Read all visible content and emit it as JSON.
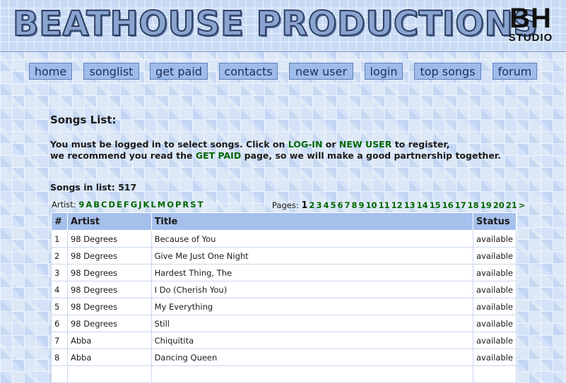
{
  "header": {
    "title": "BEATHOUSE PRODUCTIONS",
    "logo_main": "BH",
    "logo_sub": "STUDIO"
  },
  "nav": [
    "home",
    "songlist",
    "get paid",
    "contacts",
    "new user",
    "login",
    "top songs",
    "forum"
  ],
  "content": {
    "heading": "Songs List:",
    "notice": {
      "part1": "You must be logged in to select songs. Click on ",
      "login_link": "LOG-IN",
      "part2": " or ",
      "newuser_link": "NEW USER",
      "part3": " to register,",
      "part4": "we recommend you read the ",
      "getpaid_link": "GET PAID",
      "part5": " page, so we will make a good partnership together."
    },
    "count_label": "Songs in list:",
    "count_value": "517",
    "artist_label": "Artist:",
    "artist_letters": [
      "9",
      "A",
      "B",
      "C",
      "D",
      "E",
      "F",
      "G",
      "J",
      "K",
      "L",
      "M",
      "O",
      "P",
      "R",
      "S",
      "T"
    ],
    "pages_label": "Pages:",
    "current_page": "1",
    "pages": [
      "2",
      "3",
      "4",
      "5",
      "6",
      "7",
      "8",
      "9",
      "10",
      "11",
      "12",
      "13",
      "14",
      "15",
      "16",
      "17",
      "18",
      "19",
      "20",
      "21",
      ">"
    ]
  },
  "table": {
    "headers": [
      "#",
      "Artist",
      "Title",
      "Status"
    ],
    "rows": [
      [
        "1",
        "98 Degrees",
        "Because of You",
        "available"
      ],
      [
        "2",
        "98 Degrees",
        "Give Me Just One Night",
        "available"
      ],
      [
        "3",
        "98 Degrees",
        "Hardest Thing, The",
        "available"
      ],
      [
        "4",
        "98 Degrees",
        "I Do (Cherish You)",
        "available"
      ],
      [
        "5",
        "98 Degrees",
        "My Everything",
        "available"
      ],
      [
        "6",
        "98 Degrees",
        "Still",
        "available"
      ],
      [
        "7",
        "Abba",
        "Chiquitita",
        "available"
      ],
      [
        "8",
        "Abba",
        "Dancing Queen",
        "available"
      ],
      [
        "",
        "",
        "",
        ""
      ]
    ]
  },
  "colors": {
    "nav_bg": "#9fbbea",
    "link_green": "#006600",
    "table_header": "#a6c0ec"
  }
}
